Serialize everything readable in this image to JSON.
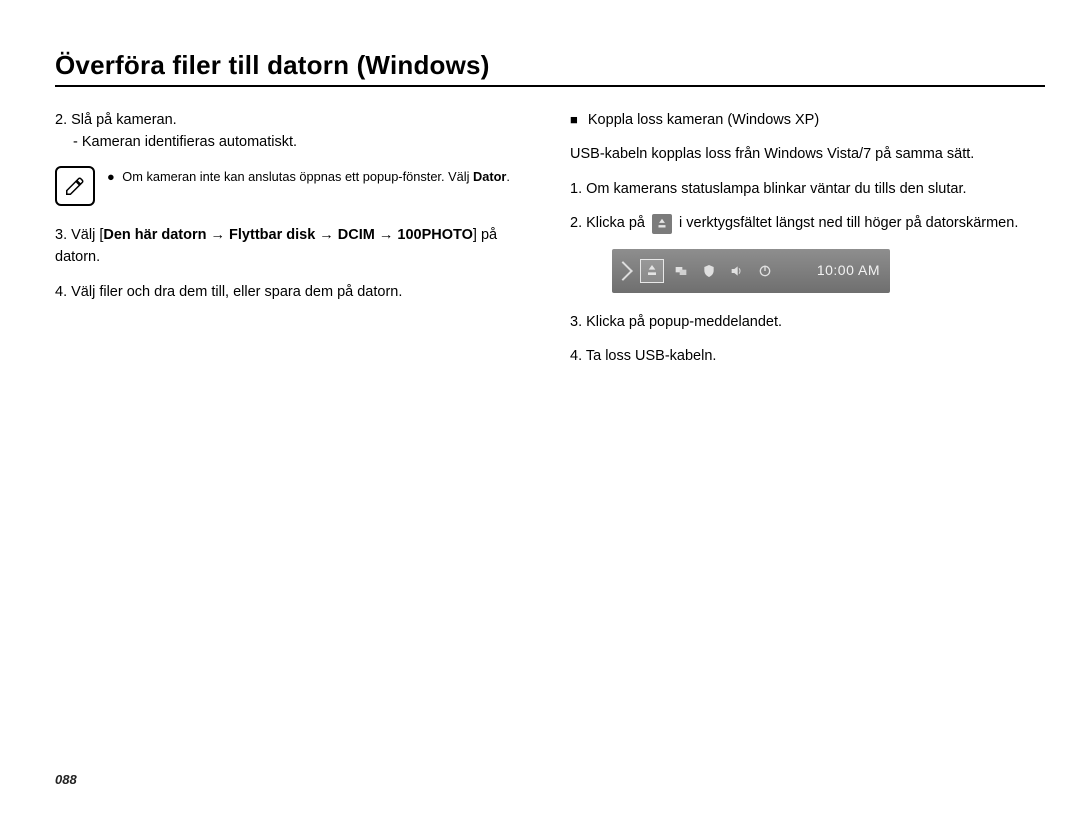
{
  "title": "Överföra filer till datorn (Windows)",
  "left": {
    "step2": "2. Slå på kameran.",
    "step2_sub": "- Kameran identifieras automatiskt.",
    "note_bullet": "●",
    "note_text_pre": "Om kameran inte kan anslutas öppnas ett popup-fönster. Välj ",
    "note_bold": "Dator",
    "note_text_post": ".",
    "step3_pre": "3. Välj [",
    "step3_bold": "Den här datorn → Flyttbar disk → DCIM → 100PHOTO",
    "step3_post": "] på datorn.",
    "step4": "4. Välj filer och dra dem till, eller spara dem på datorn."
  },
  "right": {
    "section_marker": "■",
    "section_title": "Koppla loss kameran (Windows XP)",
    "intro": "USB-kabeln kopplas loss från Windows Vista/7 på samma sätt.",
    "step1": "1. Om kamerans statuslampa blinkar väntar du tills den slutar.",
    "step2_pre": "2. Klicka på ",
    "step2_post": " i verktygsfältet längst ned till höger på datorskärmen.",
    "taskbar_clock": "10:00 AM",
    "step3": "3. Klicka på popup-meddelandet.",
    "step4": "4. Ta loss USB-kabeln."
  },
  "page_number": "088"
}
